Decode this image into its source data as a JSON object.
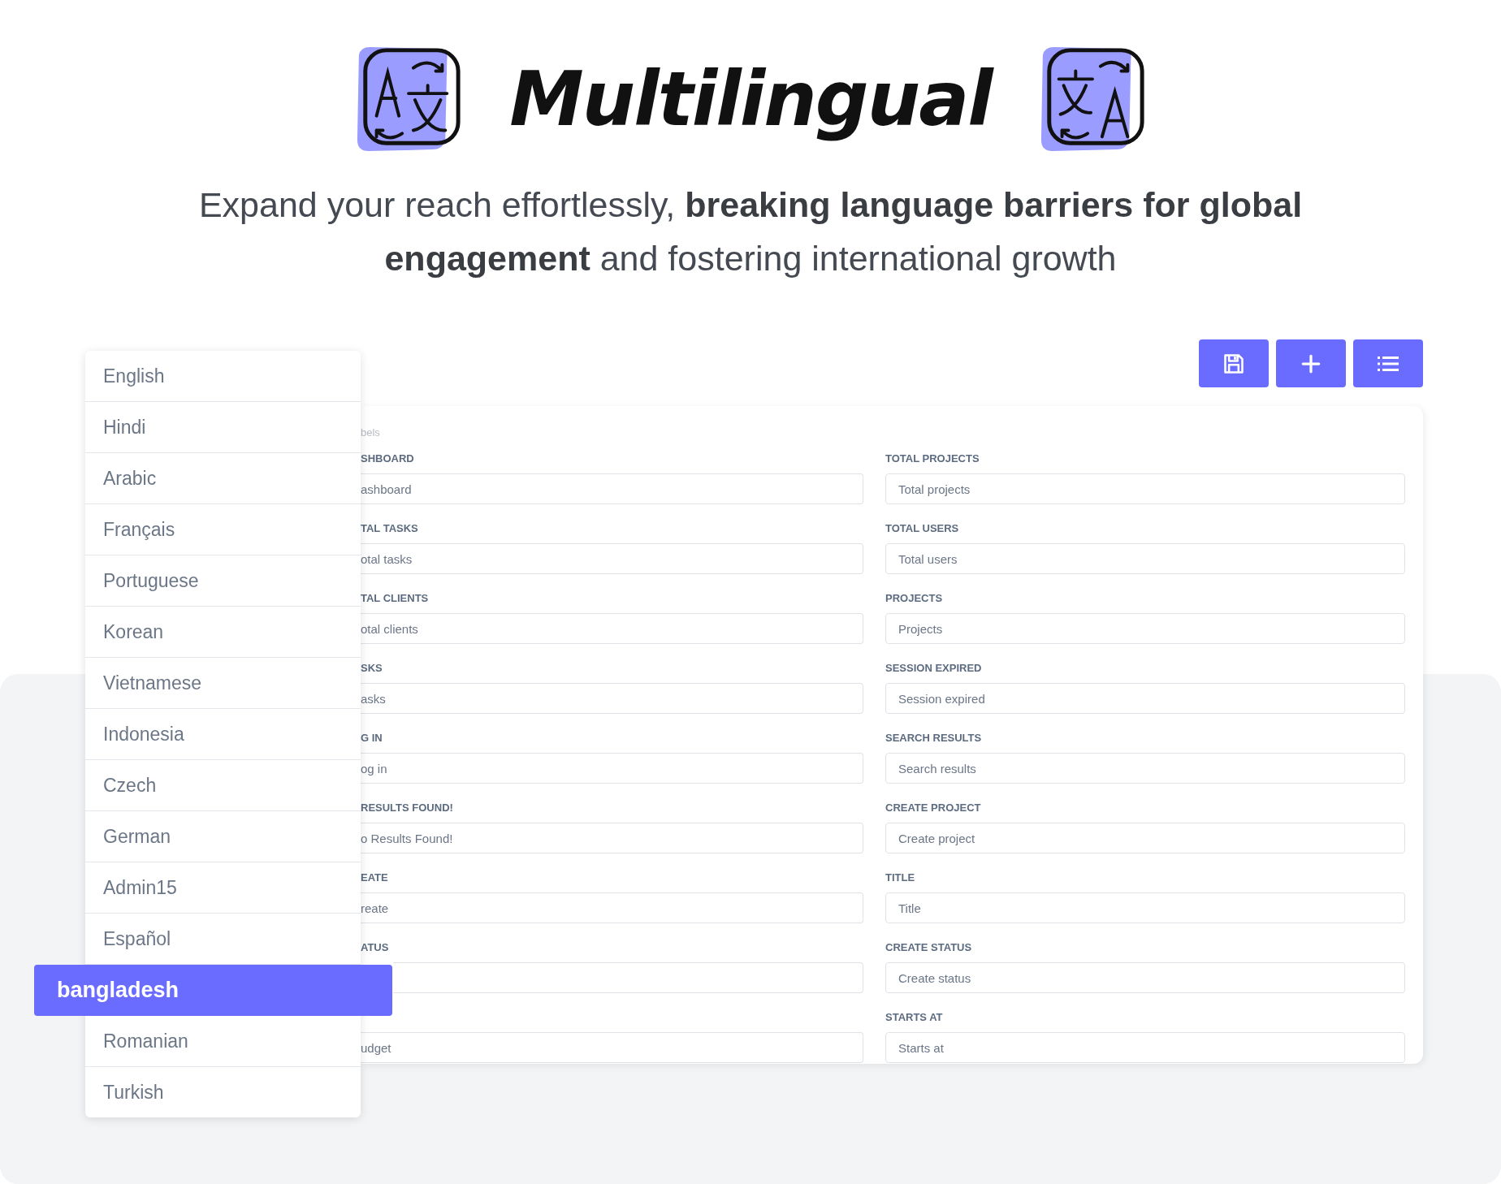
{
  "title": "Multilingual",
  "subtitle": "Expand your reach effortlessly, **breaking language barriers for global engagement** and fostering international growth",
  "languages": [
    {
      "label": "English",
      "selected": false
    },
    {
      "label": "Hindi",
      "selected": false
    },
    {
      "label": "Arabic",
      "selected": false
    },
    {
      "label": "Français",
      "selected": false
    },
    {
      "label": "Portuguese",
      "selected": false
    },
    {
      "label": "Korean",
      "selected": false
    },
    {
      "label": "Vietnamese",
      "selected": false
    },
    {
      "label": "Indonesia",
      "selected": false
    },
    {
      "label": "Czech",
      "selected": false
    },
    {
      "label": "German",
      "selected": false
    },
    {
      "label": "Admin15",
      "selected": false
    },
    {
      "label": "Español",
      "selected": false
    },
    {
      "label": "bangladesh",
      "selected": true
    },
    {
      "label": "Romanian",
      "selected": false
    },
    {
      "label": "Turkish",
      "selected": false
    }
  ],
  "toolbar": [
    {
      "kind": "save"
    },
    {
      "kind": "add"
    },
    {
      "kind": "list"
    }
  ],
  "form": {
    "heading": "bels",
    "left_column": [
      {
        "label": "SHBOARD",
        "value": "ashboard"
      },
      {
        "label": "TAL TASKS",
        "value": "otal tasks"
      },
      {
        "label": "TAL CLIENTS",
        "value": "otal clients"
      },
      {
        "label": "SKS",
        "value": "asks"
      },
      {
        "label": "G IN",
        "value": "og in"
      },
      {
        "label": "RESULTS FOUND!",
        "value": "o Results Found!"
      },
      {
        "label": "EATE",
        "value": "reate"
      },
      {
        "label": "ATUS"
      },
      {
        "value": "udget"
      }
    ],
    "right_column": [
      {
        "label": "TOTAL PROJECTS",
        "value": "Total projects"
      },
      {
        "label": "TOTAL USERS",
        "value": "Total users"
      },
      {
        "label": "PROJECTS",
        "value": "Projects"
      },
      {
        "label": "SESSION EXPIRED",
        "value": "Session expired"
      },
      {
        "label": "SEARCH RESULTS",
        "value": "Search results"
      },
      {
        "label": "CREATE PROJECT",
        "value": "Create project"
      },
      {
        "label": "TITLE",
        "value": "Title"
      },
      {
        "label": "CREATE STATUS",
        "value": "Create status"
      },
      {
        "label": "STARTS AT",
        "value": "Starts at"
      }
    ]
  }
}
